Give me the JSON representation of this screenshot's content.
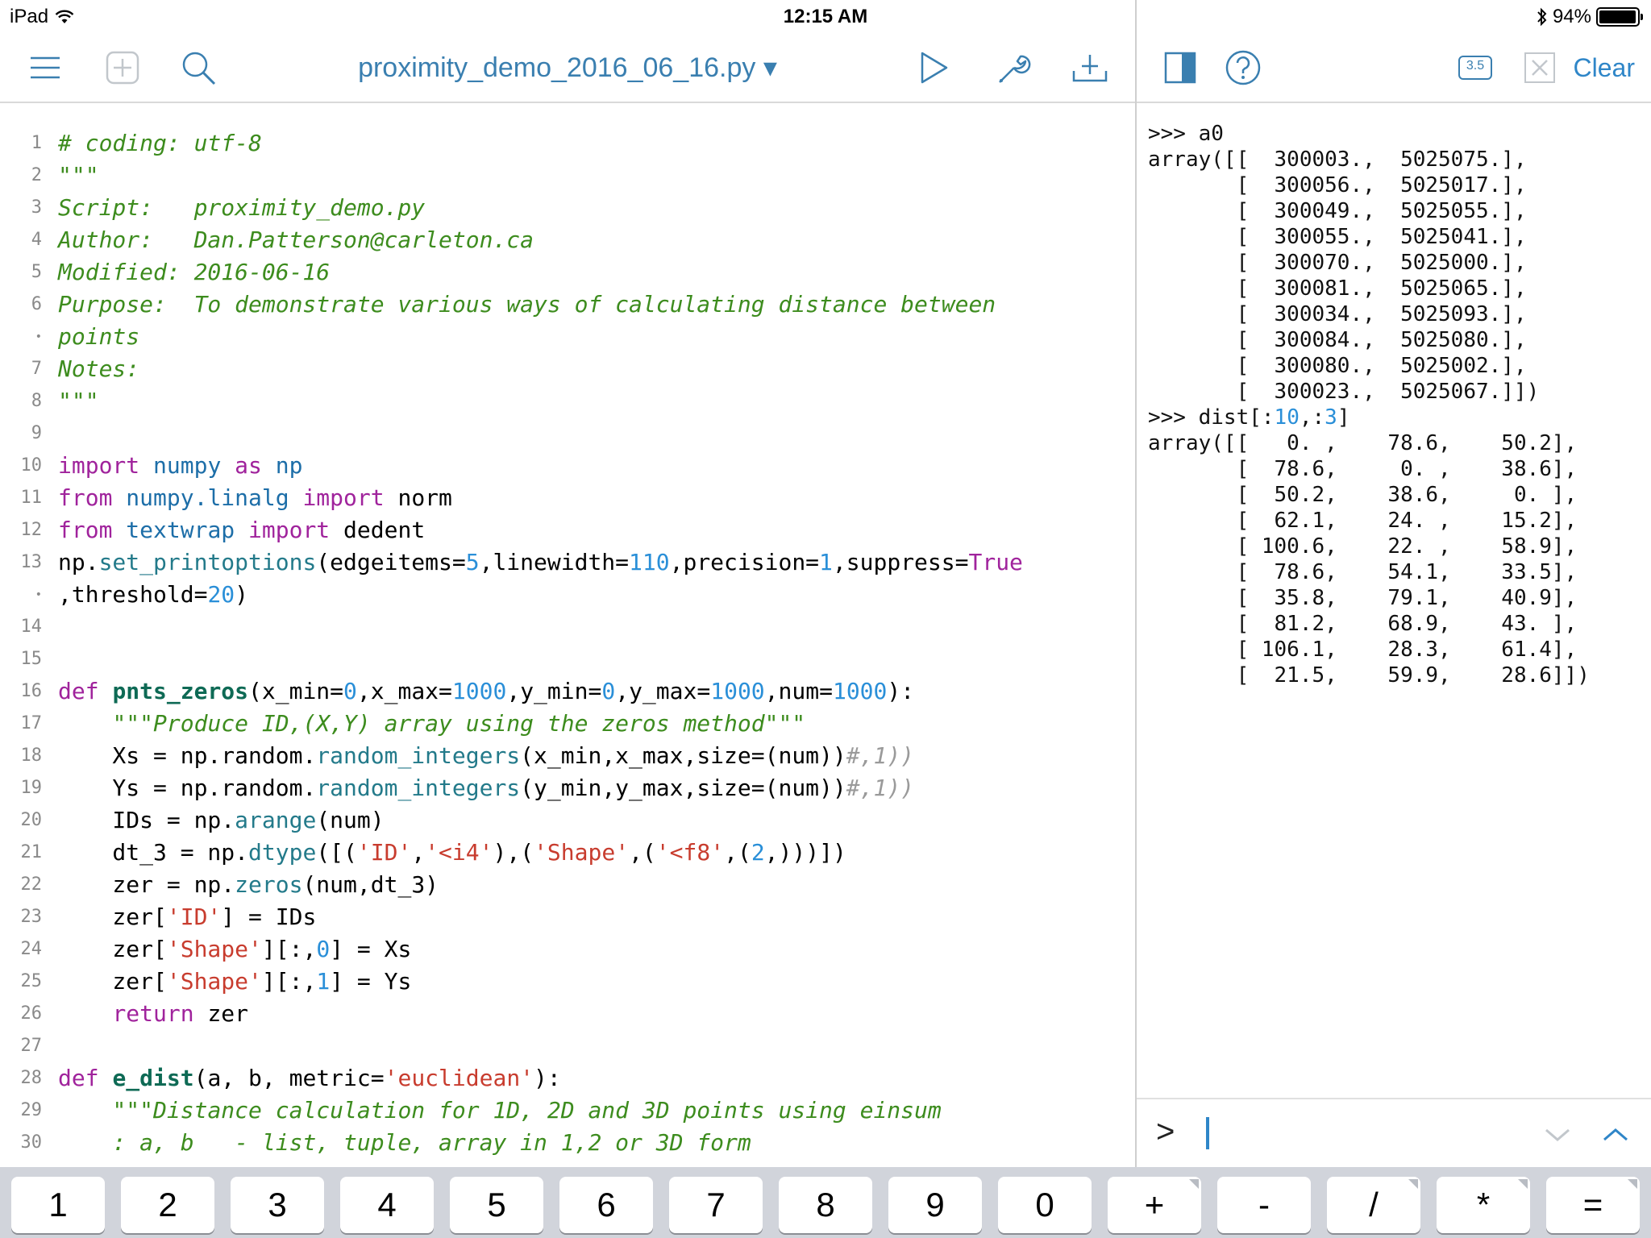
{
  "status_bar": {
    "device": "iPad",
    "time": "12:15 AM",
    "battery": "94%",
    "wifi_icon": "wifi-icon",
    "bluetooth_icon": "bluetooth-icon"
  },
  "editor_toolbar": {
    "file_title": "proximity_demo_2016_06_16.py ▾",
    "icons": [
      "menu-icon",
      "new-file-icon",
      "search-icon",
      "run-icon",
      "wrench-icon",
      "share-icon"
    ]
  },
  "console_toolbar": {
    "python_version": "3.5",
    "clear_label": "Clear",
    "icons": [
      "split-view-icon",
      "help-icon",
      "close-icon"
    ]
  },
  "editor": {
    "lines": [
      {
        "num": "1",
        "tokens": [
          [
            "c",
            "# coding: utf-8"
          ]
        ]
      },
      {
        "num": "2",
        "tokens": [
          [
            "c",
            "\"\"\""
          ]
        ]
      },
      {
        "num": "3",
        "tokens": [
          [
            "c",
            "Script:   proximity_demo.py"
          ]
        ]
      },
      {
        "num": "4",
        "tokens": [
          [
            "c",
            "Author:   Dan.Patterson@carleton.ca"
          ]
        ]
      },
      {
        "num": "5",
        "tokens": [
          [
            "c",
            "Modified: 2016-06-16"
          ]
        ]
      },
      {
        "num": "6",
        "tokens": [
          [
            "c",
            "Purpose:  To demonstrate various ways of calculating distance between"
          ]
        ]
      },
      {
        "num": "•",
        "tokens": [
          [
            "c",
            "points"
          ]
        ]
      },
      {
        "num": "7",
        "tokens": [
          [
            "c",
            "Notes:"
          ]
        ]
      },
      {
        "num": "8",
        "tokens": [
          [
            "c",
            "\"\"\""
          ]
        ]
      },
      {
        "num": "9",
        "tokens": []
      },
      {
        "num": "10",
        "tokens": [
          [
            "k",
            "import"
          ],
          [
            "",
            " "
          ],
          [
            "m",
            "numpy"
          ],
          [
            "",
            " "
          ],
          [
            "k",
            "as"
          ],
          [
            "",
            " "
          ],
          [
            "m",
            "np"
          ]
        ]
      },
      {
        "num": "11",
        "tokens": [
          [
            "k",
            "from"
          ],
          [
            "",
            " "
          ],
          [
            "m",
            "numpy.linalg"
          ],
          [
            "",
            " "
          ],
          [
            "k",
            "import"
          ],
          [
            "",
            " norm"
          ]
        ]
      },
      {
        "num": "12",
        "tokens": [
          [
            "k",
            "from"
          ],
          [
            "",
            " "
          ],
          [
            "m",
            "textwrap"
          ],
          [
            "",
            " "
          ],
          [
            "k",
            "import"
          ],
          [
            "",
            " dedent"
          ]
        ]
      },
      {
        "num": "13",
        "tokens": [
          [
            "",
            "np."
          ],
          [
            "f",
            "set_printoptions"
          ],
          [
            "",
            "(edgeitems="
          ],
          [
            "n",
            "5"
          ],
          [
            "",
            ",linewidth="
          ],
          [
            "n",
            "110"
          ],
          [
            "",
            ",precision="
          ],
          [
            "n",
            "1"
          ],
          [
            "",
            ",suppress="
          ],
          [
            "k",
            "True"
          ]
        ]
      },
      {
        "num": "•",
        "tokens": [
          [
            "",
            ",threshold="
          ],
          [
            "n",
            "20"
          ],
          [
            "",
            ")"
          ]
        ]
      },
      {
        "num": "14",
        "tokens": []
      },
      {
        "num": "15",
        "tokens": []
      },
      {
        "num": "16",
        "tokens": [
          [
            "k",
            "def"
          ],
          [
            "",
            " "
          ],
          [
            "fd",
            "pnts_zeros"
          ],
          [
            "",
            "(x_min="
          ],
          [
            "n",
            "0"
          ],
          [
            "",
            ",x_max="
          ],
          [
            "n",
            "1000"
          ],
          [
            "",
            ",y_min="
          ],
          [
            "n",
            "0"
          ],
          [
            "",
            ",y_max="
          ],
          [
            "n",
            "1000"
          ],
          [
            "",
            ",num="
          ],
          [
            "n",
            "1000"
          ],
          [
            "",
            "):"
          ]
        ]
      },
      {
        "num": "17",
        "tokens": [
          [
            "",
            "    "
          ],
          [
            "c",
            "\"\"\"Produce ID,(X,Y) array using the zeros method\"\"\""
          ]
        ]
      },
      {
        "num": "18",
        "tokens": [
          [
            "",
            "    Xs = np.random."
          ],
          [
            "f",
            "random_integers"
          ],
          [
            "",
            "(x_min,x_max,size=(num))"
          ],
          [
            "g",
            "#,1))"
          ]
        ]
      },
      {
        "num": "19",
        "tokens": [
          [
            "",
            "    Ys = np.random."
          ],
          [
            "f",
            "random_integers"
          ],
          [
            "",
            "(y_min,y_max,size=(num))"
          ],
          [
            "g",
            "#,1))"
          ]
        ]
      },
      {
        "num": "20",
        "tokens": [
          [
            "",
            "    IDs = np."
          ],
          [
            "f",
            "arange"
          ],
          [
            "",
            "(num)"
          ]
        ]
      },
      {
        "num": "21",
        "tokens": [
          [
            "",
            "    dt_3 = np."
          ],
          [
            "f",
            "dtype"
          ],
          [
            "",
            "([("
          ],
          [
            "s",
            "'ID'"
          ],
          [
            "",
            ","
          ],
          [
            "s",
            "'<i4'"
          ],
          [
            "",
            "),("
          ],
          [
            "s",
            "'Shape'"
          ],
          [
            "",
            ",("
          ],
          [
            "s",
            "'<f8'"
          ],
          [
            "",
            ",("
          ],
          [
            "n",
            "2"
          ],
          [
            "",
            ",)))])"
          ]
        ]
      },
      {
        "num": "22",
        "tokens": [
          [
            "",
            "    zer = np."
          ],
          [
            "f",
            "zeros"
          ],
          [
            "",
            "(num,dt_3)"
          ]
        ]
      },
      {
        "num": "23",
        "tokens": [
          [
            "",
            "    zer["
          ],
          [
            "s",
            "'ID'"
          ],
          [
            "",
            "] = IDs"
          ]
        ]
      },
      {
        "num": "24",
        "tokens": [
          [
            "",
            "    zer["
          ],
          [
            "s",
            "'Shape'"
          ],
          [
            "",
            "][:,"
          ],
          [
            "n",
            "0"
          ],
          [
            "",
            "] = Xs"
          ]
        ]
      },
      {
        "num": "25",
        "tokens": [
          [
            "",
            "    zer["
          ],
          [
            "s",
            "'Shape'"
          ],
          [
            "",
            "][:,"
          ],
          [
            "n",
            "1"
          ],
          [
            "",
            "] = Ys"
          ]
        ]
      },
      {
        "num": "26",
        "tokens": [
          [
            "",
            "    "
          ],
          [
            "k",
            "return"
          ],
          [
            "",
            " zer"
          ]
        ]
      },
      {
        "num": "27",
        "tokens": []
      },
      {
        "num": "28",
        "tokens": [
          [
            "k",
            "def"
          ],
          [
            "",
            " "
          ],
          [
            "fd",
            "e_dist"
          ],
          [
            "",
            "(a, b, metric="
          ],
          [
            "s",
            "'euclidean'"
          ],
          [
            "",
            "):"
          ]
        ]
      },
      {
        "num": "29",
        "tokens": [
          [
            "",
            "    "
          ],
          [
            "c",
            "\"\"\"Distance calculation for 1D, 2D and 3D points using einsum"
          ]
        ]
      },
      {
        "num": "30",
        "tokens": [
          [
            "",
            "    "
          ],
          [
            "c",
            ": a, b   - list, tuple, array in 1,2 or 3D form"
          ]
        ]
      }
    ]
  },
  "console": {
    "lines": [
      [
        [
          "",
          ">>> a0"
        ]
      ],
      [
        [
          "",
          "array([[  300003.,  5025075.],"
        ]
      ],
      [
        [
          "",
          "       [  300056.,  5025017.],"
        ]
      ],
      [
        [
          "",
          "       [  300049.,  5025055.],"
        ]
      ],
      [
        [
          "",
          "       [  300055.,  5025041.],"
        ]
      ],
      [
        [
          "",
          "       [  300070.,  5025000.],"
        ]
      ],
      [
        [
          "",
          "       [  300081.,  5025065.],"
        ]
      ],
      [
        [
          "",
          "       [  300034.,  5025093.],"
        ]
      ],
      [
        [
          "",
          "       [  300084.,  5025080.],"
        ]
      ],
      [
        [
          "",
          "       [  300080.,  5025002.],"
        ]
      ],
      [
        [
          "",
          "       [  300023.,  5025067.]])"
        ]
      ],
      [
        [
          "",
          ">>> dist[:"
        ],
        [
          "n",
          "10"
        ],
        [
          "",
          ",:"
        ],
        [
          "n",
          "3"
        ],
        [
          "",
          "]"
        ]
      ],
      [
        [
          "",
          "array([[   0. ,    78.6,    50.2],"
        ]
      ],
      [
        [
          "",
          "       [  78.6,     0. ,    38.6],"
        ]
      ],
      [
        [
          "",
          "       [  50.2,    38.6,     0. ],"
        ]
      ],
      [
        [
          "",
          "       [  62.1,    24. ,    15.2],"
        ]
      ],
      [
        [
          "",
          "       [ 100.6,    22. ,    58.9],"
        ]
      ],
      [
        [
          "",
          "       [  78.6,    54.1,    33.5],"
        ]
      ],
      [
        [
          "",
          "       [  35.8,    79.1,    40.9],"
        ]
      ],
      [
        [
          "",
          "       [  81.2,    68.9,    43. ],"
        ]
      ],
      [
        [
          "",
          "       [ 106.1,    28.3,    61.4],"
        ]
      ],
      [
        [
          "",
          "       [  21.5,    59.9,    28.6]])"
        ]
      ]
    ],
    "prompt": ">",
    "history_icons": [
      "chevron-down-icon",
      "chevron-up-icon"
    ]
  },
  "keyboard_row": {
    "keys": [
      "1",
      "2",
      "3",
      "4",
      "5",
      "6",
      "7",
      "8",
      "9",
      "0",
      "+",
      "-",
      "/",
      "*",
      "="
    ]
  }
}
